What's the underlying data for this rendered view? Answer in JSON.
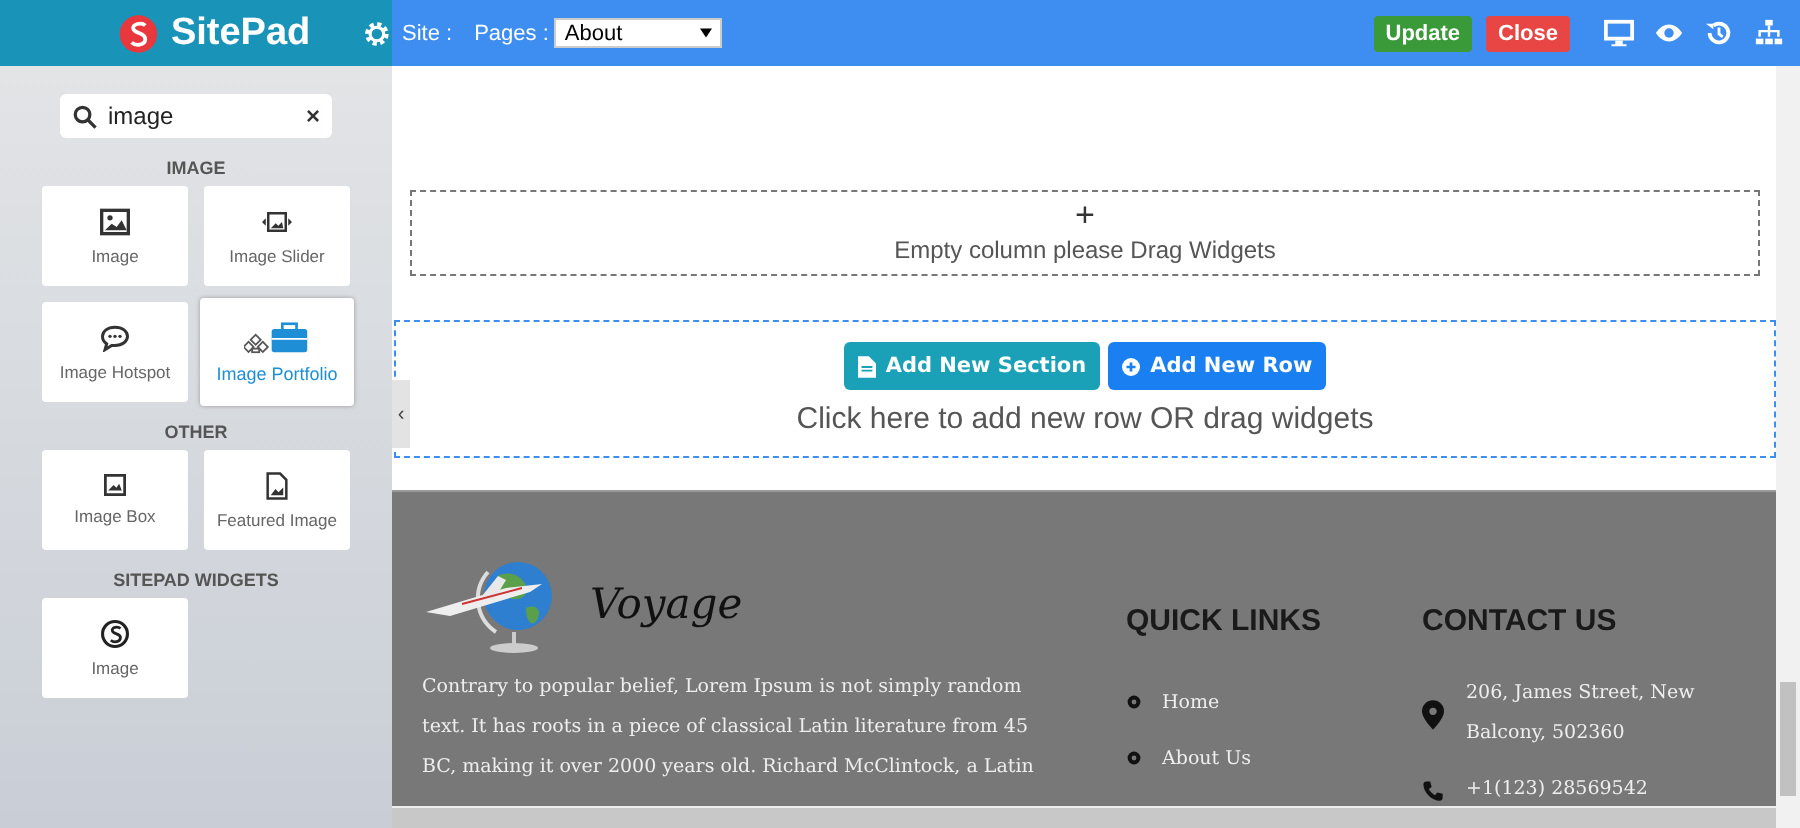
{
  "app": {
    "name": "SitePad"
  },
  "topbar": {
    "site_label": "Site :",
    "pages_label": "Pages :",
    "page_select": "About",
    "buttons": [
      {
        "label": "Update",
        "kind": "update"
      },
      {
        "label": "Close",
        "kind": "close"
      }
    ]
  },
  "sidebar": {
    "search": {
      "value": "image"
    },
    "clear": "×",
    "groups": [
      {
        "title": "IMAGE",
        "widgets": [
          {
            "label": "Image",
            "kind": "image",
            "selected": false
          },
          {
            "label": "Image Slider",
            "kind": "slider",
            "selected": false
          },
          {
            "label": "Image Hotspot",
            "kind": "hotspot",
            "selected": false
          },
          {
            "label": "Image Portfolio",
            "kind": "portfolio",
            "selected": true
          }
        ]
      },
      {
        "title": "OTHER",
        "widgets": [
          {
            "label": "Image Box",
            "kind": "box",
            "selected": false
          },
          {
            "label": "Featured Image",
            "kind": "featured",
            "selected": false
          }
        ]
      },
      {
        "title": "SITEPAD WIDGETS",
        "widgets": [
          {
            "label": "Image",
            "kind": "sitepad",
            "selected": false
          }
        ]
      }
    ],
    "toggle": "‹"
  },
  "canvas": {
    "empty_column": {
      "plus": "+",
      "text": "Empty column please Drag Widgets"
    },
    "add_row": {
      "buttons": [
        {
          "label": "Add New Section",
          "kind": "section"
        },
        {
          "label": "Add New Row",
          "kind": "row"
        }
      ],
      "text": "Click here to add new row OR drag widgets"
    },
    "footer": {
      "logo_text": "Voyage",
      "about": "Contrary to popular belief, Lorem Ipsum is not simply random text. It has roots in a piece of classical Latin literature from 45 BC, making it over 2000 years old. Richard McClintock, a Latin",
      "quick_links": {
        "title": "QUICK LINKS",
        "items": [
          "Home",
          "About Us"
        ]
      },
      "contact": {
        "title": "CONTACT US",
        "items": [
          {
            "kind": "address",
            "text": "206, James Street, New Balcony, 502360"
          },
          {
            "kind": "phone",
            "text": "+1(123) 28569542"
          }
        ]
      }
    }
  }
}
